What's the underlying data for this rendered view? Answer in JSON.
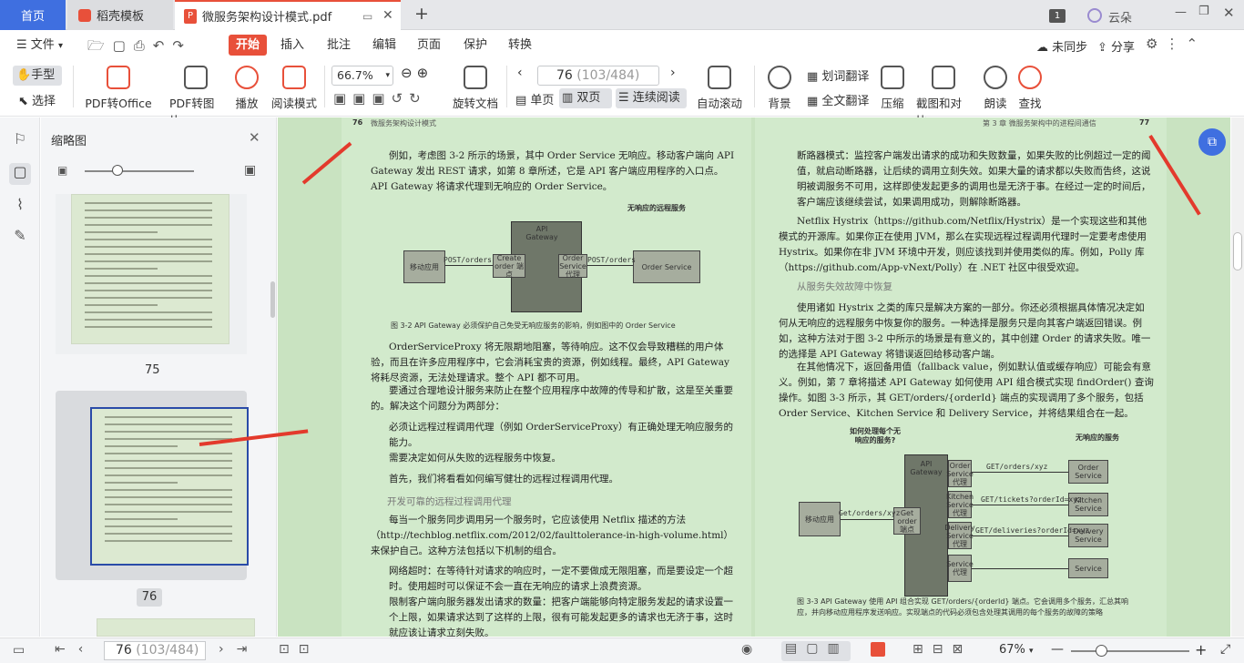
{
  "tabs": {
    "home": "首页",
    "template": "稻壳模板",
    "pdf": "微服务架构设计模式.pdf",
    "add": "+",
    "badge": "1",
    "user": "云朵"
  },
  "menu": {
    "file": "文件",
    "start": "开始",
    "insert": "插入",
    "annotate": "批注",
    "edit": "编辑",
    "page": "页面",
    "protect": "保护",
    "convert": "转换",
    "sync": "未同步",
    "share": "分享"
  },
  "toolbar": {
    "hand": "手型",
    "select": "选择",
    "pdf_office": "PDF转Office",
    "pdf_image": "PDF转图片",
    "play": "播放",
    "read_mode": "阅读模式",
    "zoom": "66.7%",
    "rotate": "旋转文档",
    "single": "单页",
    "double": "双页",
    "continuous": "连续阅读",
    "page_value": "76",
    "page_total": "(103/484)",
    "autoscroll": "自动滚动",
    "background": "背景",
    "word_translate": "划词翻译",
    "full_translate": "全文翻译",
    "compress": "压缩",
    "screenshot": "截图和对比",
    "read_aloud": "朗读",
    "find": "查找"
  },
  "sidebar": {
    "title": "缩略图",
    "thumb75": "75",
    "thumb76": "76"
  },
  "left_page": {
    "header_num": "76",
    "header_title": "微服务架构设计模式",
    "p1": "例如，考虑图 3-2 所示的场景，其中 Order Service 无响应。移动客户端向 API Gateway 发出 REST 请求，如第 8 章所述，它是 API 客户端应用程序的入口点。API Gateway 将请求代理到无响应的 Order Service。",
    "fig_note": "无响应的远程服务",
    "node_mobile": "移动应用",
    "node_gateway": "API Gateway",
    "node_create": "Create order 端点",
    "node_proxy": "Order Service 代理",
    "node_order": "Order Service",
    "edge1": "POST/orders",
    "edge2": "POST/orders",
    "caption": "图 3-2  API Gateway 必须保护自己免受无响应服务的影响，例如图中的 Order Service",
    "p2": "OrderServiceProxy 将无限期地阻塞，等待响应。这不仅会导致糟糕的用户体验，而且在许多应用程序中，它会消耗宝贵的资源，例如线程。最终，API Gateway 将耗尽资源，无法处理请求。整个 API 都不可用。",
    "p3": "要通过合理地设计服务来防止在整个应用程序中故障的传导和扩散，这是至关重要的。解决这个问题分为两部分：",
    "b1": "必须让远程过程调用代理（例如 OrderServiceProxy）有正确处理无响应服务的能力。",
    "b2": "需要决定如何从失败的远程服务中恢复。",
    "p4": "首先，我们将看看如何编写健壮的远程过程调用代理。",
    "h1": "开发可靠的远程过程调用代理",
    "p5": "每当一个服务同步调用另一个服务时，它应该使用 Netflix 描述的方法（http://techblog.netflix.com/2012/02/faulttolerance-in-high-volume.html）来保护自己。这种方法包括以下机制的组合。",
    "b3": "网络超时：在等待针对请求的响应时，一定不要做成无限阻塞，而是要设定一个超时。使用超时可以保证不会一直在无响应的请求上浪费资源。",
    "b4": "限制客户端向服务器发出请求的数量：把客户端能够向特定服务发起的请求设置一个上限，如果请求达到了这样的上限，很有可能发起更多的请求也无济于事，这时就应该让请求立刻失败。"
  },
  "right_page": {
    "header_chapter": "第 3 章  微服务架构中的进程间通信",
    "header_num": "77",
    "b1": "断路器模式：监控客户端发出请求的成功和失败数量，如果失败的比例超过一定的阈值，就启动断路器，让后续的调用立刻失效。如果大量的请求都以失败而告终，这说明被调服务不可用，这样即使发起更多的调用也是无济于事。在经过一定的时间后，客户端应该继续尝试，如果调用成功，则解除断路器。",
    "p1": "Netflix Hystrix（https://github.com/Netflix/Hystrix）是一个实现这些和其他模式的开源库。如果你正在使用 JVM，那么在实现远程过程调用代理时一定要考虑使用 Hystrix。如果你在非 JVM 环境中开发，则应该找到并使用类似的库。例如，Polly 库（https://github.com/App-vNext/Polly）在 .NET 社区中很受欢迎。",
    "h1": "从服务失效故障中恢复",
    "p2": "使用诸如 Hystrix 之类的库只是解决方案的一部分。你还必须根据具体情况决定如何从无响应的远程服务中恢复你的服务。一种选择是服务只是向其客户端返回错误。例如，这种方法对于图 3-2 中所示的场景是有意义的，其中创建 Order 的请求失败。唯一的选择是 API Gateway 将错误返回给移动客户端。",
    "p3": "在其他情况下，返回备用值（fallback value，例如默认值或缓存响应）可能会有意义。例如，第 7 章将描述 API Gateway 如何使用 API 组合模式实现 findOrder() 查询操作。如图 3-3 所示，其 GET/orders/{orderId} 端点的实现调用了多个服务，包括 Order Service、Kitchen Service 和 Delivery Service，并将结果组合在一起。",
    "fig_q": "如何处理每个无响应的服务?",
    "fig_unresp": "无响应的服务",
    "node_mobile": "移动应用",
    "node_gateway": "API Gateway",
    "node_get": "Get order 端点",
    "node_osp": "Order Service 代理",
    "node_ksp": "Kitchen Service 代理",
    "node_dsp": "Delivery Service 代理",
    "node_sp": "Service 代理",
    "node_os": "Order Service",
    "node_ks": "Kitchen Service",
    "node_ds": "Delivery Service",
    "node_s": "Service",
    "e_main": "Get/orders/xyz",
    "e1": "GET/orders/xyz",
    "e2": "GET/tickets?orderId=xyz",
    "e3": "GET/deliveries?orderId=xyz",
    "caption": "图 3-3  API Gateway 使用 API 组合实现 GET/orders/{orderId} 端点。它会调用多个服务，汇总其响应，并向移动应用程序发送响应。实现端点的代码必须包含处理其调用的每个服务的故障的策略"
  },
  "status": {
    "page_value": "76",
    "page_total": "(103/484)",
    "zoom": "67%"
  }
}
